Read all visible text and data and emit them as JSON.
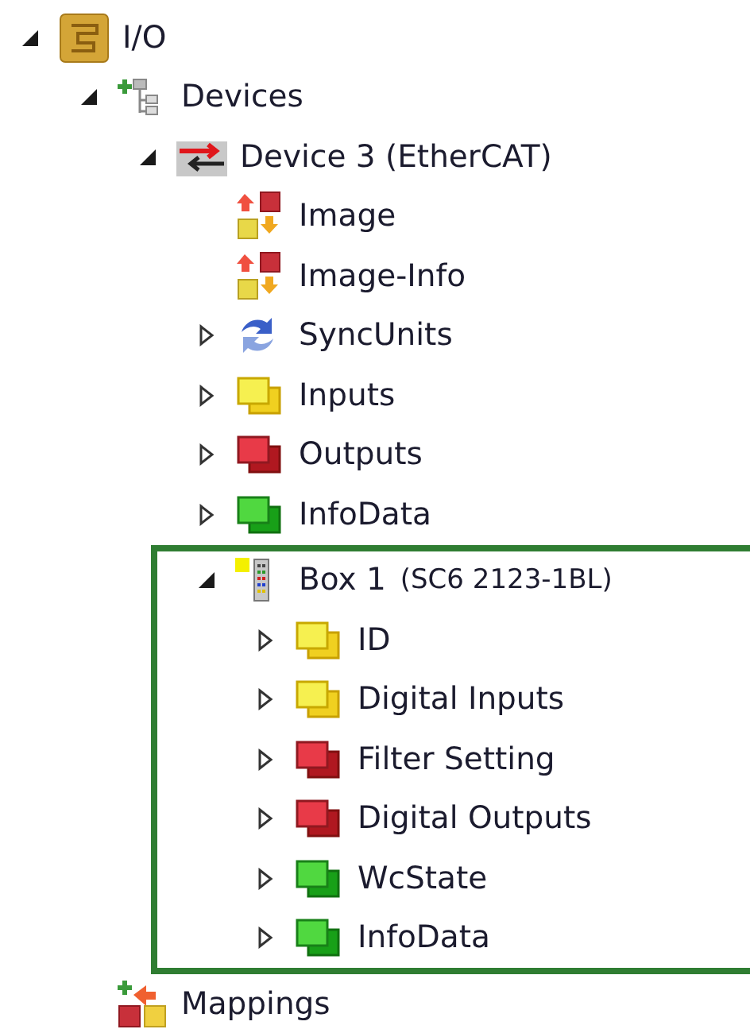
{
  "tree": [
    {
      "label": "I/O",
      "kind": "io",
      "expanded": true,
      "highlighted": false,
      "children": [
        {
          "label": "Devices",
          "kind": "devices",
          "expanded": true,
          "highlighted": false,
          "children": [
            {
              "label": "Device 3 (EtherCAT)",
              "kind": "ethercat",
              "expanded": true,
              "highlighted": false,
              "children": [
                {
                  "label": "Image",
                  "kind": "image",
                  "highlighted": false
                },
                {
                  "label": "Image-Info",
                  "kind": "image",
                  "highlighted": false
                },
                {
                  "label": "SyncUnits",
                  "kind": "sync",
                  "expanded": false,
                  "highlighted": false
                },
                {
                  "label": "Inputs",
                  "kind": "input",
                  "expanded": false,
                  "highlighted": false
                },
                {
                  "label": "Outputs",
                  "kind": "output",
                  "expanded": false,
                  "highlighted": false
                },
                {
                  "label": "InfoData",
                  "kind": "info",
                  "expanded": false,
                  "highlighted": false
                },
                {
                  "label": "Box 1",
                  "detail": "(SC6 2123-1BL)",
                  "kind": "box",
                  "expanded": true,
                  "highlighted": true,
                  "children": [
                    {
                      "label": "ID",
                      "kind": "input",
                      "expanded": false,
                      "highlighted": false
                    },
                    {
                      "label": "Digital Inputs",
                      "kind": "input",
                      "expanded": false,
                      "highlighted": false
                    },
                    {
                      "label": "Filter Setting",
                      "kind": "output",
                      "expanded": false,
                      "highlighted": false
                    },
                    {
                      "label": "Digital Outputs",
                      "kind": "output",
                      "expanded": false,
                      "highlighted": false
                    },
                    {
                      "label": "WcState",
                      "kind": "info",
                      "expanded": false,
                      "highlighted": false
                    },
                    {
                      "label": "InfoData",
                      "kind": "info",
                      "expanded": false,
                      "highlighted": false
                    }
                  ]
                }
              ]
            }
          ]
        },
        {
          "label": "Mappings",
          "kind": "mapping",
          "highlighted": false
        }
      ]
    }
  ]
}
